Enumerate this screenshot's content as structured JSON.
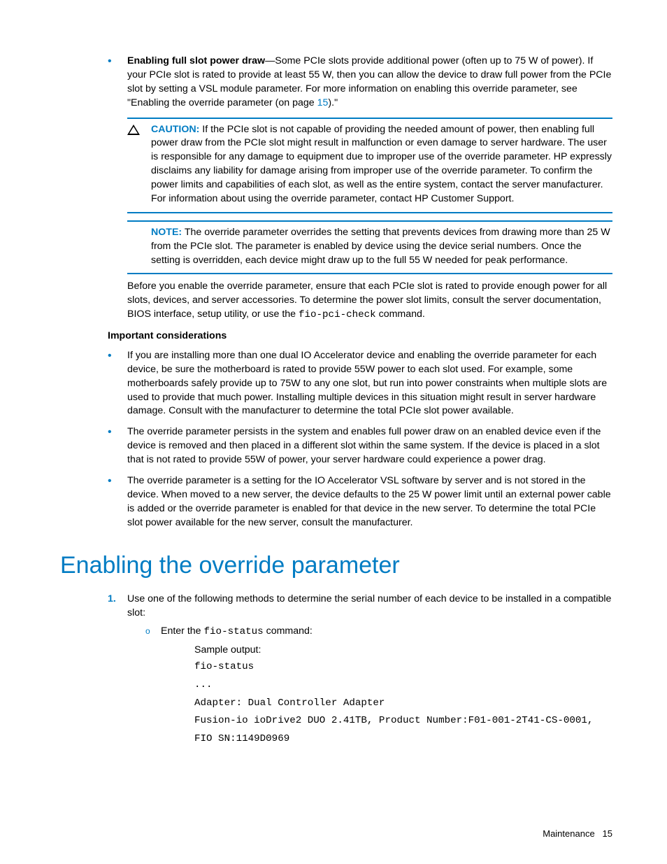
{
  "bullets_top": {
    "item1_lead": "Enabling full slot power draw",
    "item1_body": "—Some PCIe slots provide additional power (often up to 75 W of power). If your PCIe slot is rated to provide at least 55 W, then you can allow the device to draw full power from the PCIe slot by setting a VSL module parameter. For more information on enabling this override parameter, see \"Enabling the override parameter (on page ",
    "item1_link": "15",
    "item1_tail": ").\""
  },
  "caution": {
    "label": "CAUTION:",
    "body": "  If the PCIe slot is not capable of providing the needed amount of power, then enabling full power draw from the PCIe slot might result in malfunction or even damage to server hardware. The user is responsible for any damage to equipment due to improper use of the override parameter. HP expressly disclaims any liability for damage arising from improper use of the override parameter. To confirm the power limits and capabilities of each slot, as well as the entire system, contact the server manufacturer. For information about using the override parameter, contact HP Customer Support."
  },
  "note": {
    "label": "NOTE:",
    "body": "  The override parameter overrides the setting that prevents devices from drawing more than 25 W from the PCIe slot. The parameter is enabled by device using the device serial numbers. Once the setting is overridden, each device might draw up to the full 55 W needed for peak performance."
  },
  "before_para_a": "Before you enable the override parameter, ensure that each PCIe slot is rated to provide enough power for all slots, devices, and server accessories. To determine the power slot limits, consult the server documentation, BIOS interface, setup utility, or use the ",
  "before_para_cmd": "fio-pci-check",
  "before_para_b": " command.",
  "important_heading": "Important considerations",
  "considerations": [
    "If you are installing more than one dual IO Accelerator device and enabling the override parameter for each device, be sure the motherboard is rated to provide 55W power to each slot used. For example, some motherboards safely provide up to 75W to any one slot, but run into power constraints when multiple slots are used to provide that much power. Installing multiple devices in this situation might result in server hardware damage. Consult with the manufacturer to determine the total PCIe slot power available.",
    "The override parameter persists in the system and enables full power draw on an enabled device even if the device is removed and then placed in a different slot within the same system. If the device is placed in a slot that is not rated to provide 55W of power, your server hardware could experience a power drag.",
    "The override parameter is a setting for the IO Accelerator VSL software by server and is not stored in the device. When moved to a new server, the device defaults to the 25 W power limit until an external power cable is added or the override parameter is enabled for that device in the new server. To determine the total PCIe slot power available for the new server, consult the manufacturer."
  ],
  "section_heading": "Enabling the override parameter",
  "step1": {
    "num": "1.",
    "body": "Use one of the following methods to determine the serial number of each device to be installed in a compatible slot:",
    "sub_a": "Enter the ",
    "sub_cmd": "fio-status",
    "sub_b": " command:",
    "sample_label": "Sample output:",
    "code": "fio-status\n...\nAdapter: Dual Controller Adapter\nFusion-io ioDrive2 DUO 2.41TB, Product Number:F01-001-2T41-CS-0001, FIO SN:1149D0969"
  },
  "footer": {
    "section": "Maintenance",
    "page": "15"
  }
}
